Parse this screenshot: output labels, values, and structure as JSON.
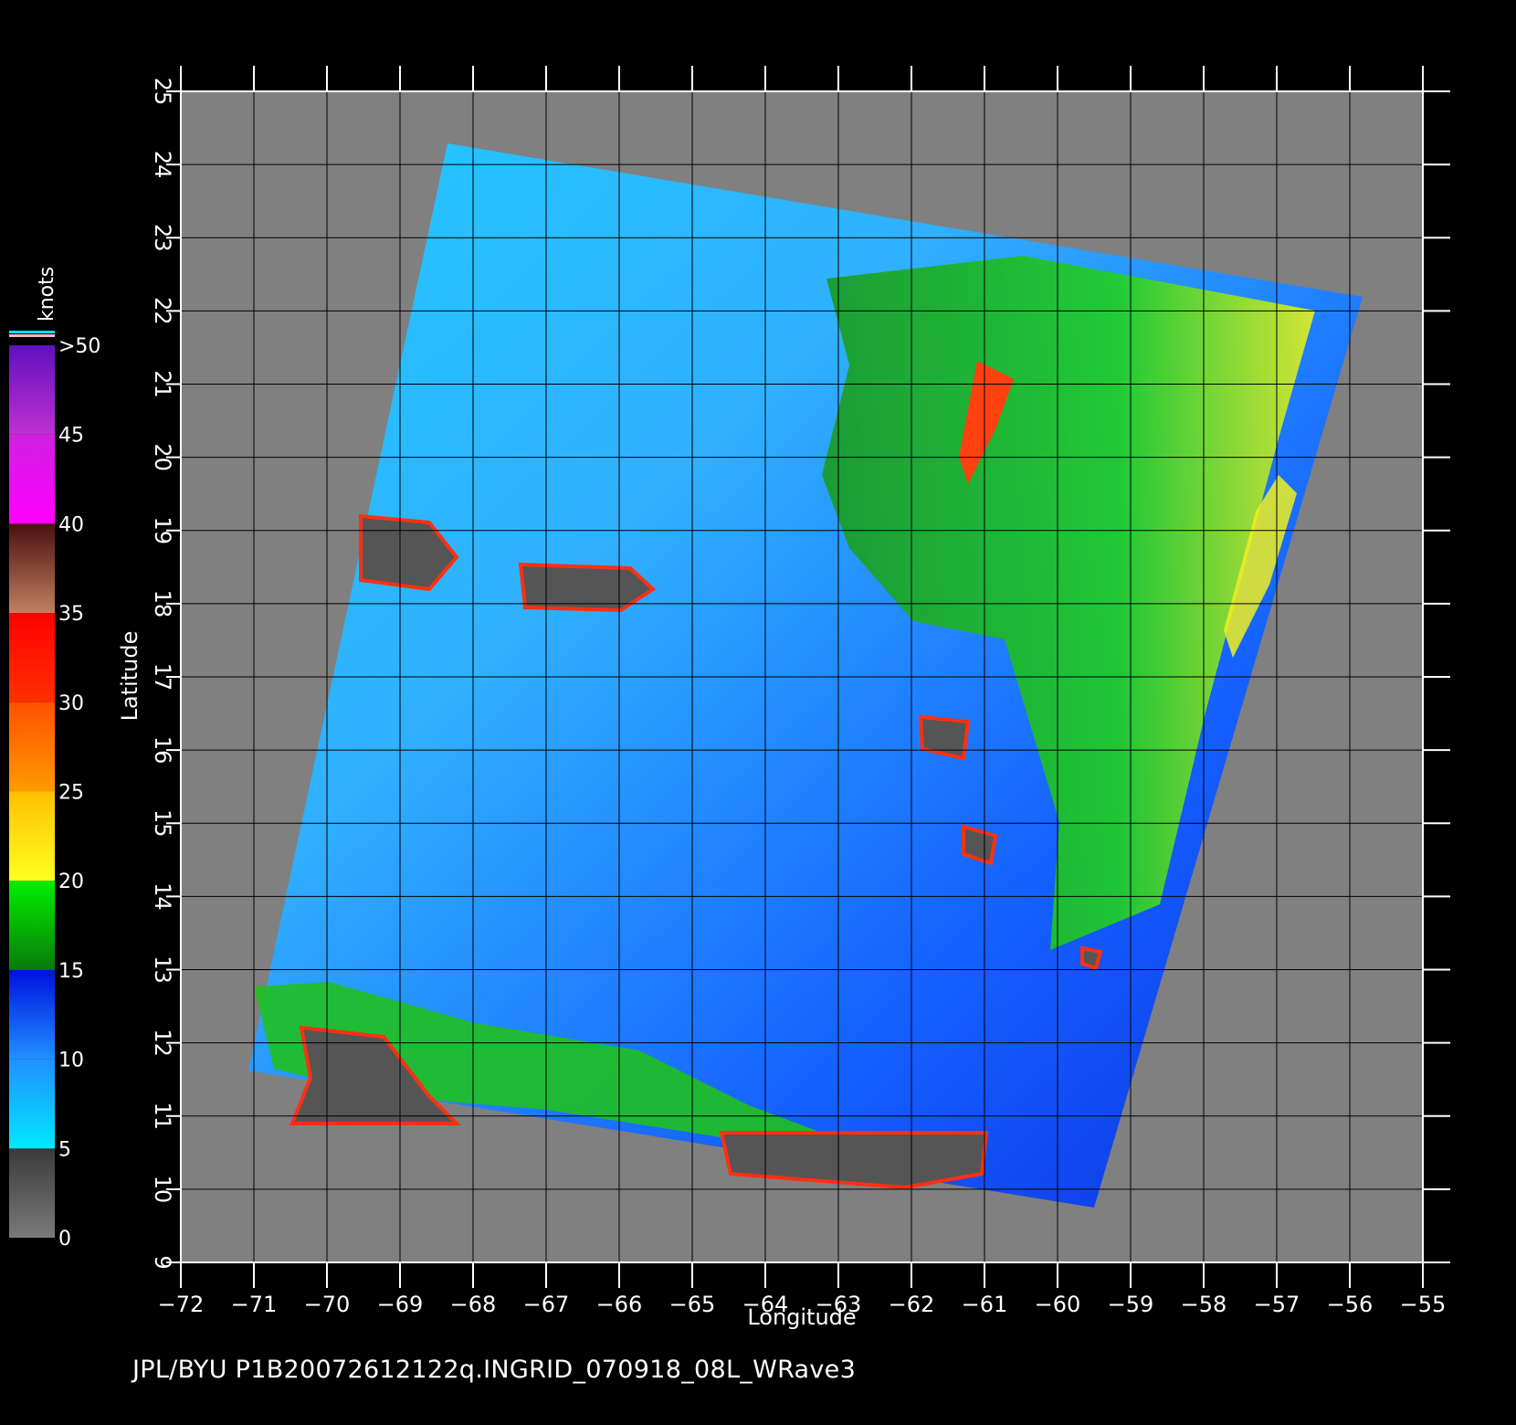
{
  "caption": "JPL/BYU  P1B20072612122q.INGRID_070918_08L_WRave3",
  "map": {
    "xlabel": "Longitude",
    "ylabel": "Latitude",
    "lon_range": [
      -72,
      -55
    ],
    "lat_range": [
      9,
      25
    ],
    "lon_ticks": [
      -72,
      -71,
      -70,
      -69,
      -68,
      -67,
      -66,
      -65,
      -64,
      -63,
      -62,
      -61,
      -60,
      -59,
      -58,
      -57,
      -56,
      -55
    ],
    "lat_ticks": [
      9,
      10,
      11,
      12,
      13,
      14,
      15,
      16,
      17,
      18,
      19,
      20,
      21,
      22,
      23,
      24,
      25
    ],
    "lon_tick_labels": [
      "−72",
      "−71",
      "−70",
      "−69",
      "−68",
      "−67",
      "−66",
      "−65",
      "−64",
      "−63",
      "−62",
      "−61",
      "−60",
      "−59",
      "−58",
      "−57",
      "−56",
      "−55"
    ],
    "lat_tick_labels": [
      "9",
      "10",
      "11",
      "12",
      "13",
      "14",
      "15",
      "16",
      "17",
      "18",
      "19",
      "20",
      "21",
      "22",
      "23",
      "24",
      "25"
    ],
    "grid": true,
    "background_color": "#808080",
    "land_color": "#555555"
  },
  "colorbar": {
    "title": "knots",
    "labels": [
      "0",
      "5",
      "10",
      "15",
      "20",
      "25",
      "30",
      "35",
      "40",
      "45",
      ">50"
    ],
    "bands": [
      {
        "from": 0,
        "to": 5,
        "c1": "#7a7a7a",
        "c2": "#3a3a3a"
      },
      {
        "from": 5,
        "to": 10,
        "c1": "#00e8ff",
        "c2": "#2090ff"
      },
      {
        "from": 10,
        "to": 15,
        "c1": "#2090ff",
        "c2": "#0010e0"
      },
      {
        "from": 15,
        "to": 20,
        "c1": "#0a7a0a",
        "c2": "#00f000"
      },
      {
        "from": 20,
        "to": 25,
        "c1": "#ffff20",
        "c2": "#ffc000"
      },
      {
        "from": 25,
        "to": 30,
        "c1": "#ff9a00",
        "c2": "#ff5000"
      },
      {
        "from": 30,
        "to": 35,
        "c1": "#ff3000",
        "c2": "#ff0000"
      },
      {
        "from": 35,
        "to": 40,
        "c1": "#c08060",
        "c2": "#4a1010"
      },
      {
        "from": 40,
        "to": 45,
        "c1": "#ff00ff",
        "c2": "#d020e0"
      },
      {
        "from": 45,
        "to": 50,
        "c1": "#c030d0",
        "c2": "#6010c0"
      }
    ],
    "range": [
      0,
      50
    ]
  }
}
